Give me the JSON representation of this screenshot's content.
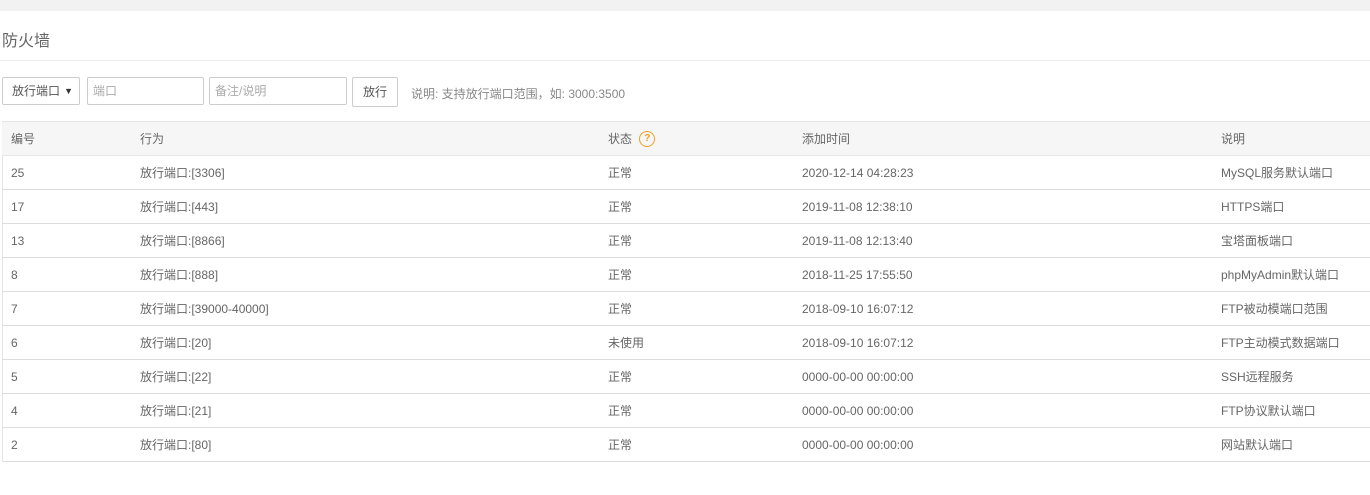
{
  "page": {
    "title": "防火墙"
  },
  "toolbar": {
    "select_value": "放行端口",
    "port_placeholder": "端口",
    "note_placeholder": "备注/说明",
    "submit_label": "放行",
    "hint": "说明: 支持放行端口范围，如: 3000:3500"
  },
  "table": {
    "headers": [
      "编号",
      "行为",
      "状态",
      "添加时间",
      "说明"
    ],
    "rows": [
      [
        "25",
        "放行端口:[3306]",
        "正常",
        "2020-12-14 04:28:23",
        "MySQL服务默认端口"
      ],
      [
        "17",
        "放行端口:[443]",
        "正常",
        "2019-11-08 12:38:10",
        "HTTPS端口"
      ],
      [
        "13",
        "放行端口:[8866]",
        "正常",
        "2019-11-08 12:13:40",
        "宝塔面板端口"
      ],
      [
        "8",
        "放行端口:[888]",
        "正常",
        "2018-11-25 17:55:50",
        "phpMyAdmin默认端口"
      ],
      [
        "7",
        "放行端口:[39000-40000]",
        "正常",
        "2018-09-10 16:07:12",
        "FTP被动模端口范围"
      ],
      [
        "6",
        "放行端口:[20]",
        "未使用",
        "2018-09-10 16:07:12",
        "FTP主动模式数据端口"
      ],
      [
        "5",
        "放行端口:[22]",
        "正常",
        "0000-00-00 00:00:00",
        "SSH远程服务"
      ],
      [
        "4",
        "放行端口:[21]",
        "正常",
        "0000-00-00 00:00:00",
        "FTP协议默认端口"
      ],
      [
        "2",
        "放行端口:[80]",
        "正常",
        "0000-00-00 00:00:00",
        "网站默认端口"
      ]
    ]
  },
  "icons": {
    "help": "question-circle-icon",
    "help_glyph": "?",
    "caret": "▼"
  },
  "colors": {
    "accent": "#f0a020"
  }
}
